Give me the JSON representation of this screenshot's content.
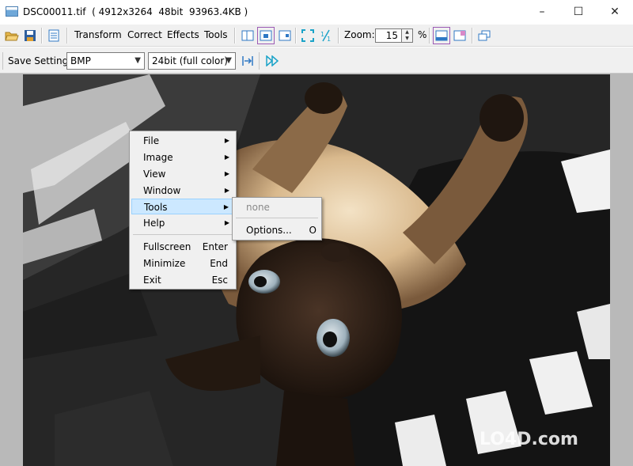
{
  "window": {
    "title": "DSC00011.tif  ( 4912x3264  48bit  93963.4KB )",
    "minimize": "–",
    "maximize": "☐",
    "close": "✕"
  },
  "toolbar": {
    "open_icon": "folder-open-icon",
    "save_icon": "save-icon",
    "doc_icon": "document-icon",
    "menus": [
      "Transform",
      "Correct",
      "Effects",
      "Tools"
    ],
    "zoom_label": "Zoom:",
    "zoom_value": "15",
    "zoom_unit": "%"
  },
  "save_bar": {
    "label": "Save Settings",
    "format": "BMP",
    "depth": "24bit (full color)"
  },
  "context_menu": {
    "items": [
      {
        "label": "File",
        "submenu": true
      },
      {
        "label": "Image",
        "submenu": true
      },
      {
        "label": "View",
        "submenu": true
      },
      {
        "label": "Window",
        "submenu": true
      },
      {
        "label": "Tools",
        "submenu": true,
        "highlighted": true
      },
      {
        "label": "Help",
        "submenu": true
      },
      {
        "label": "Fullscreen",
        "shortcut": "Enter"
      },
      {
        "label": "Minimize",
        "shortcut": "End"
      },
      {
        "label": "Exit",
        "shortcut": "Esc"
      }
    ],
    "tools_submenu": {
      "disabled_item": "none",
      "options_label": "Options...",
      "options_shortcut": "O"
    }
  },
  "watermark": "LO4D.com",
  "colors": {
    "accent_frame": "#9b5ab4",
    "menu_highlight": "#cce8ff",
    "toolbar_bg": "#f0f0f0",
    "icon_blue": "#2f78c4",
    "icon_cyan": "#1aa3c8"
  }
}
